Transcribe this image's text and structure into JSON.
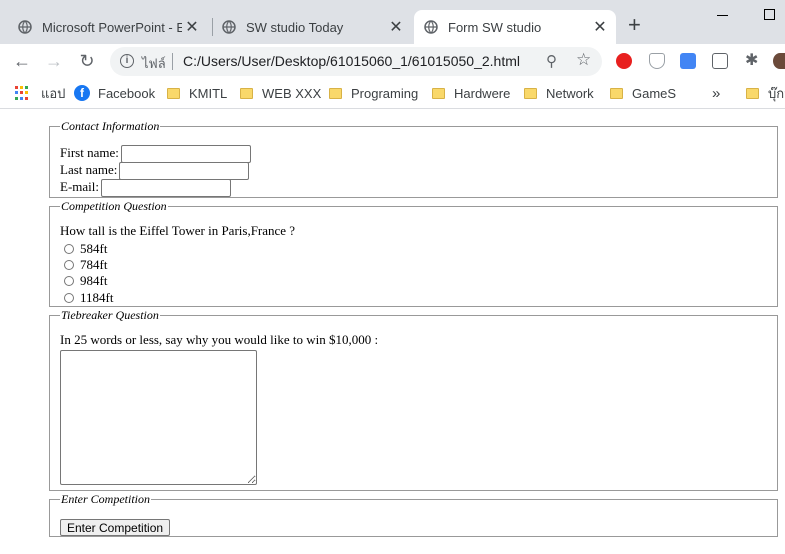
{
  "browser": {
    "tabs": [
      {
        "title": "Microsoft PowerPoint - Ex"
      },
      {
        "title": "SW studio Today"
      },
      {
        "title": "Form SW studio"
      }
    ],
    "new_tab_label": "+",
    "address_bar": {
      "scheme_label": "ไฟล์",
      "url": "C:/Users/User/Desktop/61015060_1/61015050_2.html"
    },
    "bookmarks": {
      "apps_label": "แอป",
      "items": [
        "Facebook",
        "KMITL",
        "WEB XXX",
        "Programing",
        "Hardwere",
        "Network",
        "GameS"
      ],
      "overflow": "»",
      "other": "บุ๊กม"
    }
  },
  "form": {
    "contact": {
      "legend": "Contact Information",
      "first_name_label": "First name:",
      "last_name_label": "Last name:",
      "email_label": "E-mail:"
    },
    "competition": {
      "legend": "Competition Question",
      "question": "How tall is the Eiffel Tower in Paris,France ?",
      "options": [
        "584ft",
        "784ft",
        "984ft",
        "1184ft"
      ]
    },
    "tiebreaker": {
      "legend": "Tiebreaker Question",
      "prompt": "In 25 words or less, say why you would like to win $10,000 :"
    },
    "enter": {
      "legend": "Enter Competition",
      "button_label": "Enter Competition"
    }
  }
}
